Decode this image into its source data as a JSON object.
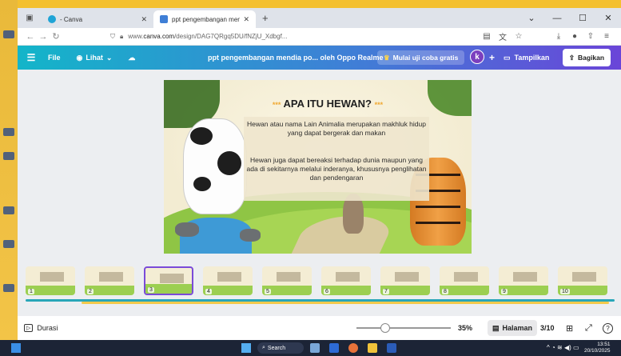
{
  "browser": {
    "tabs": [
      {
        "label": "- Canva",
        "active": false
      },
      {
        "label": "ppt pengembangan mendia pe",
        "active": true
      }
    ],
    "url_prefix": "www.",
    "url_domain": "canva.com",
    "url_rest": "/design/DAG7QRgq5DU/fNZjU_Xdbgf...",
    "new_tab_symbol": "+"
  },
  "canva_toolbar": {
    "file_label": "File",
    "view_label": "Lihat",
    "design_title": "ppt pengembangan mendia po... oleh Oppo Realme",
    "trial_label": "Mulai uji coba gratis",
    "avatar_letter": "k",
    "show_label": "Tampilkan",
    "share_label": "Bagikan"
  },
  "slide": {
    "heading": "APA ITU HEWAN?",
    "heading_deco": "***",
    "paragraph1": "Hewan atau nama Lain Animalia merupakan makhluk hidup yang dapat bergerak dan makan",
    "paragraph2": "Hewan juga dapat bereaksi terhadap dunia maupun yang ada di sekitarnya melalui inderanya, khususnya penglihatan dan pendengaran"
  },
  "thumbnails": [
    {
      "num": "1"
    },
    {
      "num": "2"
    },
    {
      "num": "3",
      "selected": true
    },
    {
      "num": "4"
    },
    {
      "num": "5"
    },
    {
      "num": "6"
    },
    {
      "num": "7"
    },
    {
      "num": "8"
    },
    {
      "num": "9"
    },
    {
      "num": "10"
    }
  ],
  "bottom_bar": {
    "duration_label": "Durasi",
    "zoom": "35%",
    "pages_label": "Halaman",
    "page_count": "3/10",
    "help": "?"
  },
  "taskbar": {
    "search_label": "Search",
    "time": "13:51",
    "date": "20/10/2025"
  },
  "colors": {
    "toolbar_start": "#13b5c9",
    "toolbar_end": "#6a45d8",
    "selection": "#7a4ad8",
    "desktop": "#f4c030"
  }
}
